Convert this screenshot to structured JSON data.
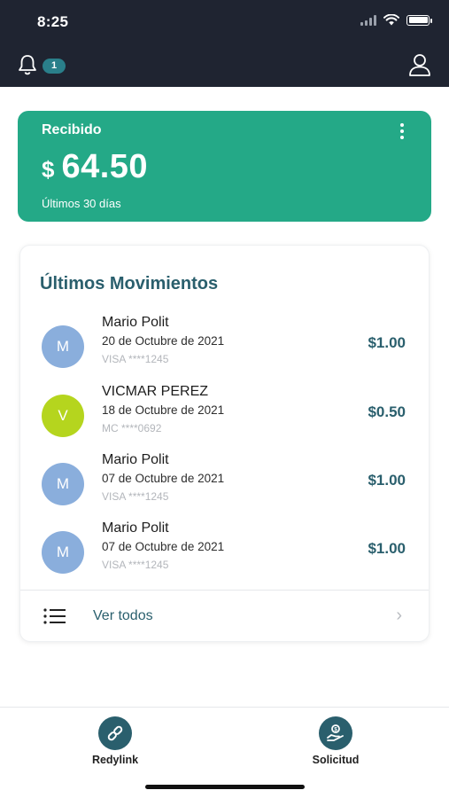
{
  "status_bar": {
    "time": "8:25"
  },
  "header": {
    "notification_count": "1"
  },
  "received_card": {
    "title": "Recibido",
    "currency": "$",
    "amount": "64.50",
    "period": "Últimos 30 días",
    "color": "#24a987"
  },
  "movements": {
    "title": "Últimos Movimientos",
    "items": [
      {
        "initial": "M",
        "name": "Mario Polit",
        "date": "20 de Octubre de 2021",
        "card": "VISA ****1245",
        "amount": "$1.00",
        "avatar_color": "#8aaedc"
      },
      {
        "initial": "V",
        "name": "VICMAR PEREZ",
        "date": "18 de Octubre de 2021",
        "card": "MC ****0692",
        "amount": "$0.50",
        "avatar_color": "#b5d51e"
      },
      {
        "initial": "M",
        "name": "Mario Polit",
        "date": "07 de Octubre de 2021",
        "card": "VISA ****1245",
        "amount": "$1.00",
        "avatar_color": "#8aaedc"
      },
      {
        "initial": "M",
        "name": "Mario Polit",
        "date": "07 de Octubre de 2021",
        "card": "VISA ****1245",
        "amount": "$1.00",
        "avatar_color": "#8aaedc"
      }
    ],
    "see_all_label": "Ver todos"
  },
  "bottom_nav": {
    "items": [
      {
        "label": "Redylink",
        "icon": "link-icon"
      },
      {
        "label": "Solicitud",
        "icon": "request-money-icon"
      }
    ]
  },
  "colors": {
    "header_bg": "#1f2431",
    "accent": "#2a5f6d",
    "green": "#24a987"
  }
}
